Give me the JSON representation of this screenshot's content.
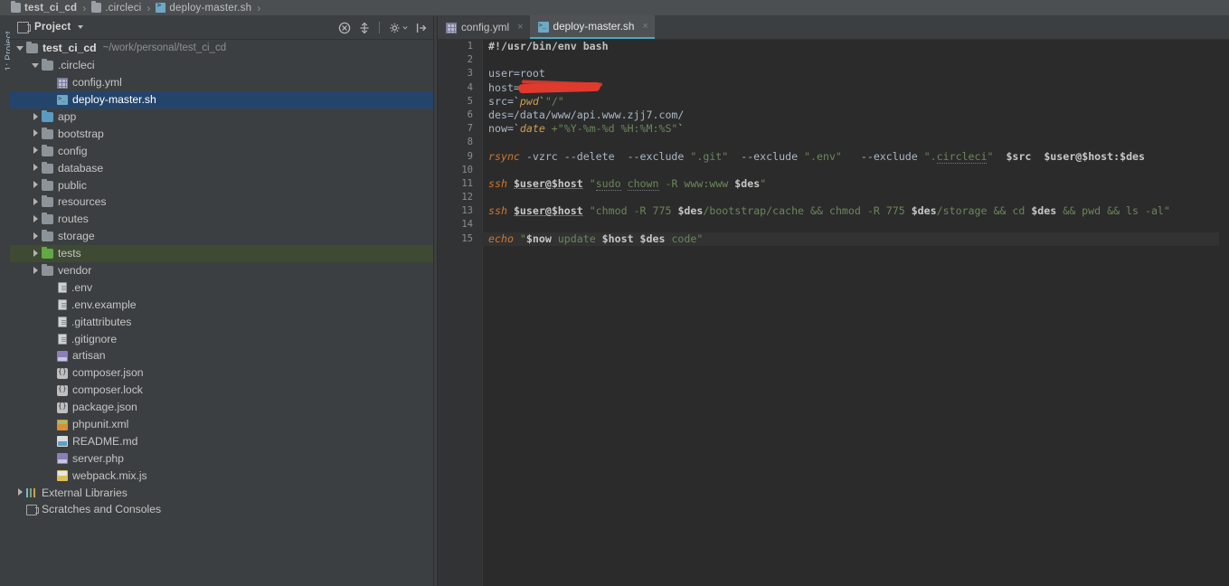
{
  "breadcrumb": {
    "items": [
      {
        "label": "test_ci_cd",
        "icon": "folder-icon",
        "bold": true
      },
      {
        "label": ".circleci",
        "icon": "folder-icon",
        "bold": false
      },
      {
        "label": "deploy-master.sh",
        "icon": "shell-file-icon",
        "bold": false
      }
    ],
    "separator": "›"
  },
  "left_strip": {
    "label": "1: Project"
  },
  "project_panel": {
    "title": "Project",
    "caret": "▾",
    "toolbar": [
      {
        "name": "collapse-all-icon",
        "tooltip": "Collapse All"
      },
      {
        "name": "scroll-from-source-icon",
        "tooltip": "Select Opened File"
      },
      {
        "name": "settings-gear-icon",
        "tooltip": "Settings"
      },
      {
        "name": "hide-panel-icon",
        "tooltip": "Hide"
      }
    ],
    "tree": [
      {
        "label": "test_ci_cd",
        "path": "~/work/personal/test_ci_cd",
        "indent": 0,
        "arrow": "open",
        "icon": "folder-grey",
        "bold": true,
        "state": "normal"
      },
      {
        "label": ".circleci",
        "path": "",
        "indent": 1,
        "arrow": "open",
        "icon": "folder-grey",
        "bold": false,
        "state": "normal"
      },
      {
        "label": "config.yml",
        "path": "",
        "indent": 2,
        "arrow": "none",
        "icon": "yaml-file",
        "bold": false,
        "state": "normal"
      },
      {
        "label": "deploy-master.sh",
        "path": "",
        "indent": 2,
        "arrow": "none",
        "icon": "shell-file",
        "bold": false,
        "state": "selected"
      },
      {
        "label": "app",
        "path": "",
        "indent": 1,
        "arrow": "closed",
        "icon": "folder-blue",
        "bold": false,
        "state": "normal"
      },
      {
        "label": "bootstrap",
        "path": "",
        "indent": 1,
        "arrow": "closed",
        "icon": "folder-grey",
        "bold": false,
        "state": "normal"
      },
      {
        "label": "config",
        "path": "",
        "indent": 1,
        "arrow": "closed",
        "icon": "folder-grey",
        "bold": false,
        "state": "normal"
      },
      {
        "label": "database",
        "path": "",
        "indent": 1,
        "arrow": "closed",
        "icon": "folder-grey",
        "bold": false,
        "state": "normal"
      },
      {
        "label": "public",
        "path": "",
        "indent": 1,
        "arrow": "closed",
        "icon": "folder-grey",
        "bold": false,
        "state": "normal"
      },
      {
        "label": "resources",
        "path": "",
        "indent": 1,
        "arrow": "closed",
        "icon": "folder-grey",
        "bold": false,
        "state": "normal"
      },
      {
        "label": "routes",
        "path": "",
        "indent": 1,
        "arrow": "closed",
        "icon": "folder-grey",
        "bold": false,
        "state": "normal"
      },
      {
        "label": "storage",
        "path": "",
        "indent": 1,
        "arrow": "closed",
        "icon": "folder-grey",
        "bold": false,
        "state": "normal"
      },
      {
        "label": "tests",
        "path": "",
        "indent": 1,
        "arrow": "closed",
        "icon": "folder-green",
        "bold": false,
        "state": "green"
      },
      {
        "label": "vendor",
        "path": "",
        "indent": 1,
        "arrow": "closed",
        "icon": "folder-grey",
        "bold": false,
        "state": "normal"
      },
      {
        "label": ".env",
        "path": "",
        "indent": 2,
        "arrow": "none",
        "icon": "text-file",
        "bold": false,
        "state": "normal"
      },
      {
        "label": ".env.example",
        "path": "",
        "indent": 2,
        "arrow": "none",
        "icon": "text-file",
        "bold": false,
        "state": "normal"
      },
      {
        "label": ".gitattributes",
        "path": "",
        "indent": 2,
        "arrow": "none",
        "icon": "text-file",
        "bold": false,
        "state": "normal"
      },
      {
        "label": ".gitignore",
        "path": "",
        "indent": 2,
        "arrow": "none",
        "icon": "text-file",
        "bold": false,
        "state": "normal"
      },
      {
        "label": "artisan",
        "path": "",
        "indent": 2,
        "arrow": "none",
        "icon": "php-file",
        "bold": false,
        "state": "normal"
      },
      {
        "label": "composer.json",
        "path": "",
        "indent": 2,
        "arrow": "none",
        "icon": "json-file",
        "bold": false,
        "state": "normal"
      },
      {
        "label": "composer.lock",
        "path": "",
        "indent": 2,
        "arrow": "none",
        "icon": "json-file",
        "bold": false,
        "state": "normal"
      },
      {
        "label": "package.json",
        "path": "",
        "indent": 2,
        "arrow": "none",
        "icon": "json-file",
        "bold": false,
        "state": "normal"
      },
      {
        "label": "phpunit.xml",
        "path": "",
        "indent": 2,
        "arrow": "none",
        "icon": "xml-file",
        "bold": false,
        "state": "normal"
      },
      {
        "label": "README.md",
        "path": "",
        "indent": 2,
        "arrow": "none",
        "icon": "markdown-file",
        "bold": false,
        "state": "normal"
      },
      {
        "label": "server.php",
        "path": "",
        "indent": 2,
        "arrow": "none",
        "icon": "php-file",
        "bold": false,
        "state": "normal"
      },
      {
        "label": "webpack.mix.js",
        "path": "",
        "indent": 2,
        "arrow": "none",
        "icon": "js-file",
        "bold": false,
        "state": "normal"
      },
      {
        "label": "External Libraries",
        "path": "",
        "indent": 0,
        "arrow": "closed",
        "icon": "library-icon",
        "bold": false,
        "state": "normal"
      },
      {
        "label": "Scratches and Consoles",
        "path": "",
        "indent": 0,
        "arrow": "none",
        "icon": "scratch-icon",
        "bold": false,
        "state": "normal"
      }
    ]
  },
  "editor": {
    "tabs": [
      {
        "label": "config.yml",
        "icon": "yaml-file-icon",
        "active": false,
        "close": "×"
      },
      {
        "label": "deploy-master.sh",
        "icon": "shell-file-icon",
        "active": true,
        "close": "×"
      }
    ],
    "active_tab_accent": "#4aa8bd",
    "current_line": 15,
    "line_numbers": [
      "1",
      "2",
      "3",
      "4",
      "5",
      "6",
      "7",
      "8",
      "9",
      "10",
      "11",
      "12",
      "13",
      "14",
      "15"
    ],
    "lines": [
      {
        "n": 1,
        "text": "#!/usr/bin/env bash"
      },
      {
        "n": 2,
        "text": ""
      },
      {
        "n": 3,
        "text": "user=root"
      },
      {
        "n": 4,
        "text": "host=<redacted>"
      },
      {
        "n": 5,
        "text": "src=`pwd`\"/\""
      },
      {
        "n": 6,
        "text": "des=/data/www/api.www.zjj7.com/"
      },
      {
        "n": 7,
        "text": "now=`date +\"%Y-%m-%d %H:%M:%S\"`"
      },
      {
        "n": 8,
        "text": ""
      },
      {
        "n": 9,
        "text": "rsync -vzrc --delete  --exclude \".git\"  --exclude \".env\"   --exclude \".circleci\"  $src  $user@$host:$des"
      },
      {
        "n": 10,
        "text": ""
      },
      {
        "n": 11,
        "text": "ssh $user@$host \"sudo chown -R www:www $des\""
      },
      {
        "n": 12,
        "text": ""
      },
      {
        "n": 13,
        "text": "ssh $user@$host \"chmod -R 775 $des/bootstrap/cache && chmod -R 775 $des/storage && cd $des && pwd && ls -al\""
      },
      {
        "n": 14,
        "text": ""
      },
      {
        "n": 15,
        "text": "echo \"$now update $host $des code\""
      }
    ],
    "redacted_value": "host value hidden by red marker"
  },
  "colors": {
    "panel_bg": "#3c3f41",
    "editor_bg": "#2b2b2b",
    "gutter_bg": "#313335",
    "selection_blue": "#24456b",
    "tests_green": "#3f4a33",
    "accent_cyan": "#4aa8bd",
    "redaction_red": "#e03a2f",
    "string_green": "#6a8759",
    "keyword_orange": "#cc7832"
  }
}
